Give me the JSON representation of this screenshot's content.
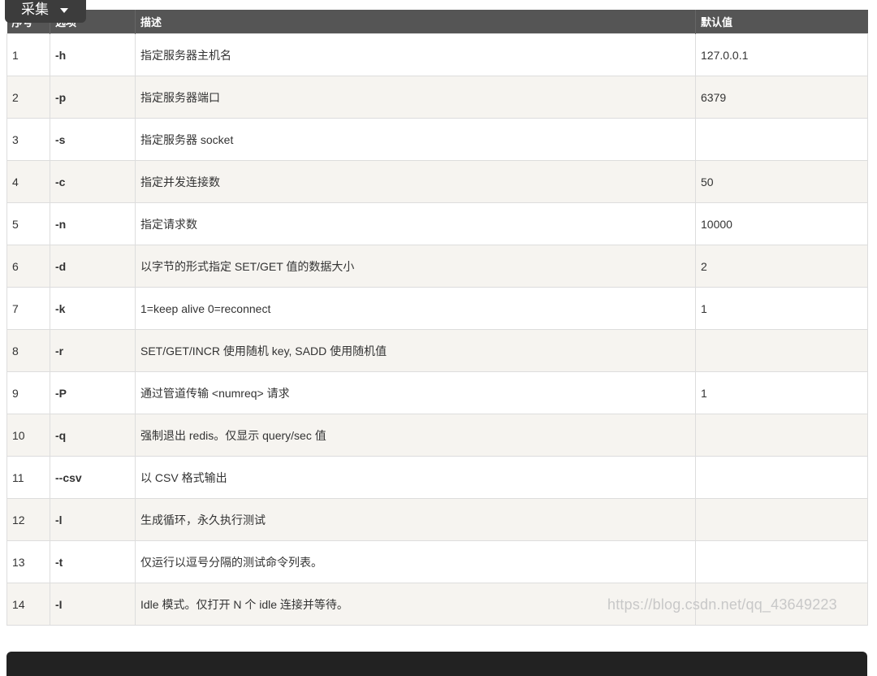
{
  "collect_button": {
    "label": "采集"
  },
  "table": {
    "headers": [
      "序号",
      "选项",
      "描述",
      "默认值"
    ],
    "rows": [
      [
        "1",
        "-h",
        "指定服务器主机名",
        "127.0.0.1"
      ],
      [
        "2",
        "-p",
        "指定服务器端口",
        "6379"
      ],
      [
        "3",
        "-s",
        "指定服务器 socket",
        ""
      ],
      [
        "4",
        "-c",
        "指定并发连接数",
        "50"
      ],
      [
        "5",
        "-n",
        "指定请求数",
        "10000"
      ],
      [
        "6",
        "-d",
        "以字节的形式指定 SET/GET 值的数据大小",
        "2"
      ],
      [
        "7",
        "-k",
        "1=keep alive 0=reconnect",
        "1"
      ],
      [
        "8",
        "-r",
        "SET/GET/INCR 使用随机 key, SADD 使用随机值",
        ""
      ],
      [
        "9",
        "-P",
        "通过管道传输 <numreq> 请求",
        "1"
      ],
      [
        "10",
        "-q",
        "强制退出 redis。仅显示 query/sec 值",
        ""
      ],
      [
        "11",
        "--csv",
        "以 CSV 格式输出",
        ""
      ],
      [
        "12",
        "-l",
        "生成循环，永久执行测试",
        ""
      ],
      [
        "13",
        "-t",
        "仅运行以逗号分隔的测试命令列表。",
        ""
      ],
      [
        "14",
        "-I",
        "Idle 模式。仅打开 N 个 idle 连接并等待。",
        ""
      ]
    ]
  },
  "watermark": "https://blog.csdn.net/qq_43649223"
}
